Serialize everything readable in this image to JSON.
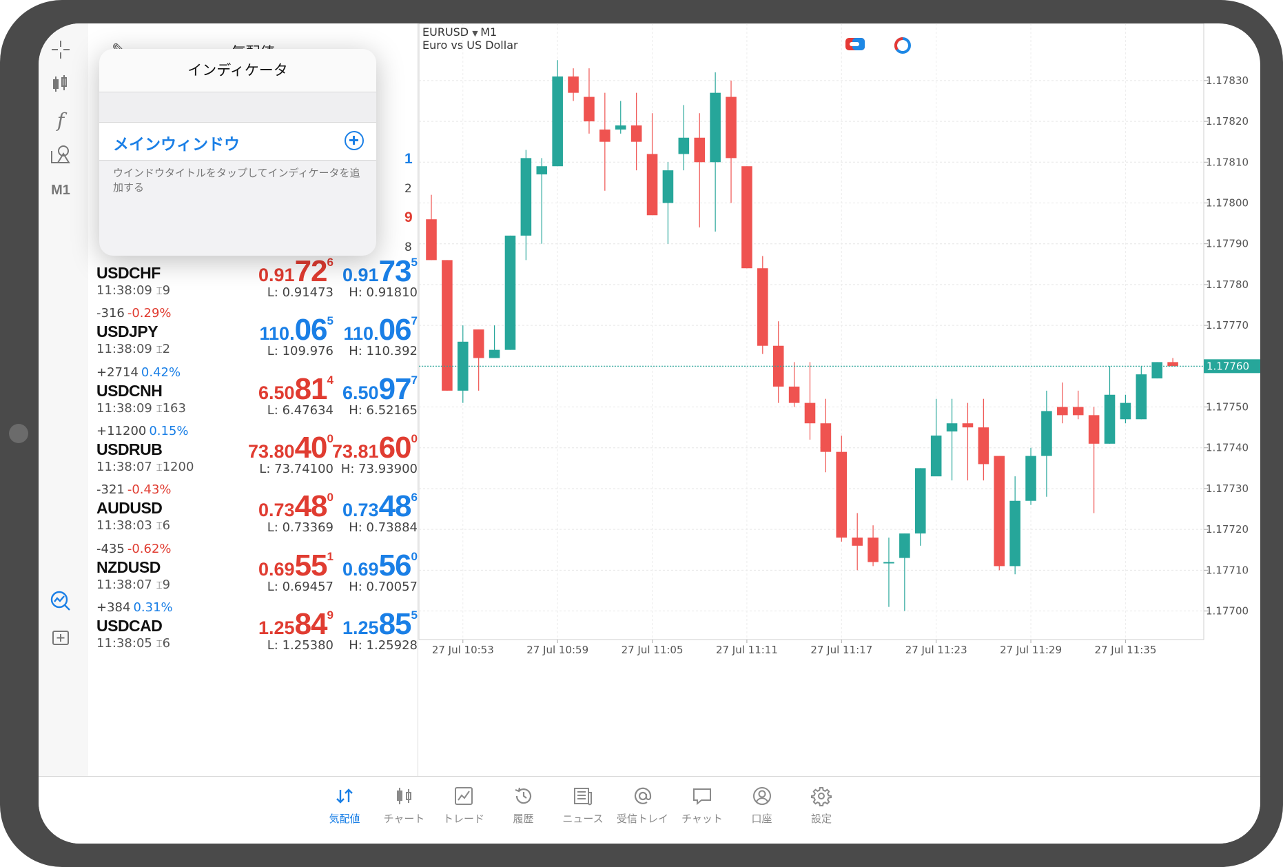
{
  "quotes_header": {
    "title": "気配値"
  },
  "popover": {
    "title": "インディケータ",
    "main_window_label": "メインウィンドウ",
    "hint": "ウインドウタイトルをタップしてインディケータを追加する"
  },
  "toolstrip": {
    "timeframe": "M1"
  },
  "partial_rows": [
    "1",
    "2",
    "9",
    "8"
  ],
  "quotes": [
    {
      "change": "",
      "pct": "",
      "pct_color": "",
      "symbol": "USDCHF",
      "time": "11:38:09",
      "spread": "9",
      "bid": {
        "small": "0.91",
        "big": "72",
        "pip": "6",
        "color": "red"
      },
      "ask": {
        "small": "0.91",
        "big": "73",
        "pip": "5",
        "color": "blue"
      },
      "low": "L: 0.91473",
      "high": "H: 0.91810"
    },
    {
      "change": "-316",
      "pct": "-0.29%",
      "pct_color": "red",
      "symbol": "USDJPY",
      "time": "11:38:09",
      "spread": "2",
      "bid": {
        "small": "110.",
        "big": "06",
        "pip": "5",
        "color": "blue"
      },
      "ask": {
        "small": "110.",
        "big": "06",
        "pip": "7",
        "color": "blue"
      },
      "low": "L: 109.976",
      "high": "H: 110.392"
    },
    {
      "change": "+2714",
      "pct": "0.42%",
      "pct_color": "blue",
      "symbol": "USDCNH",
      "time": "11:38:09",
      "spread": "163",
      "bid": {
        "small": "6.50",
        "big": "81",
        "pip": "4",
        "color": "red"
      },
      "ask": {
        "small": "6.50",
        "big": "97",
        "pip": "7",
        "color": "blue"
      },
      "low": "L: 6.47634",
      "high": "H: 6.52165"
    },
    {
      "change": "+11200",
      "pct": "0.15%",
      "pct_color": "blue",
      "symbol": "USDRUB",
      "time": "11:38:07",
      "spread": "1200",
      "bid": {
        "small": "73.80",
        "big": "40",
        "pip": "0",
        "color": "red"
      },
      "ask": {
        "small": "73.81",
        "big": "60",
        "pip": "0",
        "color": "red"
      },
      "low": "L: 73.74100",
      "high": "H: 73.93900"
    },
    {
      "change": "-321",
      "pct": "-0.43%",
      "pct_color": "red",
      "symbol": "AUDUSD",
      "time": "11:38:03",
      "spread": "6",
      "bid": {
        "small": "0.73",
        "big": "48",
        "pip": "0",
        "color": "red"
      },
      "ask": {
        "small": "0.73",
        "big": "48",
        "pip": "6",
        "color": "blue"
      },
      "low": "L: 0.73369",
      "high": "H: 0.73884"
    },
    {
      "change": "-435",
      "pct": "-0.62%",
      "pct_color": "red",
      "symbol": "NZDUSD",
      "time": "11:38:07",
      "spread": "9",
      "bid": {
        "small": "0.69",
        "big": "55",
        "pip": "1",
        "color": "red"
      },
      "ask": {
        "small": "0.69",
        "big": "56",
        "pip": "0",
        "color": "blue"
      },
      "low": "L: 0.69457",
      "high": "H: 0.70057"
    },
    {
      "change": "+384",
      "pct": "0.31%",
      "pct_color": "blue",
      "symbol": "USDCAD",
      "time": "11:38:05",
      "spread": "6",
      "bid": {
        "small": "1.25",
        "big": "84",
        "pip": "9",
        "color": "red"
      },
      "ask": {
        "small": "1.25",
        "big": "85",
        "pip": "5",
        "color": "blue"
      },
      "low": "L: 1.25380",
      "high": "H: 1.25928"
    }
  ],
  "chart_data": {
    "type": "candlestick",
    "symbol": "EURUSD",
    "timeframe": "M1",
    "description": "Euro vs US Dollar",
    "current_price": "1.17760",
    "y_ticks": [
      "1.17830",
      "1.17820",
      "1.17810",
      "1.17800",
      "1.17790",
      "1.17780",
      "1.17770",
      "1.17760",
      "1.17750",
      "1.17740",
      "1.17730",
      "1.17720",
      "1.17710",
      "1.17700"
    ],
    "x_ticks": [
      "27 Jul 10:53",
      "27 Jul 10:59",
      "27 Jul 11:05",
      "27 Jul 11:11",
      "27 Jul 11:17",
      "27 Jul 11:23",
      "27 Jul 11:29",
      "27 Jul 11:35"
    ],
    "y_range": [
      1.17693,
      1.17844
    ],
    "candles": [
      {
        "o": 1.17796,
        "h": 1.17802,
        "l": 1.17786,
        "c": 1.17786
      },
      {
        "o": 1.17786,
        "h": 1.17786,
        "l": 1.17754,
        "c": 1.17754
      },
      {
        "o": 1.17754,
        "h": 1.1777,
        "l": 1.17751,
        "c": 1.17766
      },
      {
        "o": 1.17769,
        "h": 1.17769,
        "l": 1.17754,
        "c": 1.17762
      },
      {
        "o": 1.17762,
        "h": 1.1777,
        "l": 1.17762,
        "c": 1.17764
      },
      {
        "o": 1.17764,
        "h": 1.17792,
        "l": 1.17764,
        "c": 1.17792
      },
      {
        "o": 1.17792,
        "h": 1.17813,
        "l": 1.17786,
        "c": 1.17811
      },
      {
        "o": 1.17807,
        "h": 1.17811,
        "l": 1.1779,
        "c": 1.17809
      },
      {
        "o": 1.17809,
        "h": 1.17835,
        "l": 1.17809,
        "c": 1.17831
      },
      {
        "o": 1.17831,
        "h": 1.17833,
        "l": 1.17825,
        "c": 1.17827
      },
      {
        "o": 1.17826,
        "h": 1.17833,
        "l": 1.17817,
        "c": 1.1782
      },
      {
        "o": 1.17818,
        "h": 1.17827,
        "l": 1.17803,
        "c": 1.17815
      },
      {
        "o": 1.17818,
        "h": 1.17825,
        "l": 1.17817,
        "c": 1.17819
      },
      {
        "o": 1.17819,
        "h": 1.17827,
        "l": 1.17808,
        "c": 1.17815
      },
      {
        "o": 1.17812,
        "h": 1.17822,
        "l": 1.17798,
        "c": 1.17797
      },
      {
        "o": 1.178,
        "h": 1.1781,
        "l": 1.1779,
        "c": 1.17808
      },
      {
        "o": 1.17812,
        "h": 1.17824,
        "l": 1.17808,
        "c": 1.17816
      },
      {
        "o": 1.17816,
        "h": 1.17822,
        "l": 1.17794,
        "c": 1.1781
      },
      {
        "o": 1.1781,
        "h": 1.17832,
        "l": 1.17793,
        "c": 1.17827
      },
      {
        "o": 1.17826,
        "h": 1.1783,
        "l": 1.178,
        "c": 1.17811
      },
      {
        "o": 1.17809,
        "h": 1.17809,
        "l": 1.17784,
        "c": 1.17784
      },
      {
        "o": 1.17784,
        "h": 1.17787,
        "l": 1.17763,
        "c": 1.17765
      },
      {
        "o": 1.17765,
        "h": 1.17771,
        "l": 1.17751,
        "c": 1.17755
      },
      {
        "o": 1.17755,
        "h": 1.17761,
        "l": 1.1775,
        "c": 1.17751
      },
      {
        "o": 1.17751,
        "h": 1.17761,
        "l": 1.17742,
        "c": 1.17746
      },
      {
        "o": 1.17746,
        "h": 1.17752,
        "l": 1.17734,
        "c": 1.17739
      },
      {
        "o": 1.17739,
        "h": 1.17743,
        "l": 1.17717,
        "c": 1.17718
      },
      {
        "o": 1.17718,
        "h": 1.17724,
        "l": 1.1771,
        "c": 1.17716
      },
      {
        "o": 1.17718,
        "h": 1.17721,
        "l": 1.17711,
        "c": 1.17712
      },
      {
        "o": 1.17712,
        "h": 1.17718,
        "l": 1.17701,
        "c": 1.17712
      },
      {
        "o": 1.17713,
        "h": 1.17719,
        "l": 1.177,
        "c": 1.17719
      },
      {
        "o": 1.17719,
        "h": 1.17735,
        "l": 1.17716,
        "c": 1.17735
      },
      {
        "o": 1.17733,
        "h": 1.17752,
        "l": 1.17734,
        "c": 1.17743
      },
      {
        "o": 1.17744,
        "h": 1.17752,
        "l": 1.17732,
        "c": 1.17746
      },
      {
        "o": 1.17746,
        "h": 1.17751,
        "l": 1.17732,
        "c": 1.17745
      },
      {
        "o": 1.17745,
        "h": 1.17752,
        "l": 1.17732,
        "c": 1.17736
      },
      {
        "o": 1.17738,
        "h": 1.17738,
        "l": 1.1771,
        "c": 1.17711
      },
      {
        "o": 1.17711,
        "h": 1.17733,
        "l": 1.17709,
        "c": 1.17727
      },
      {
        "o": 1.17727,
        "h": 1.1774,
        "l": 1.17726,
        "c": 1.17738
      },
      {
        "o": 1.17738,
        "h": 1.17754,
        "l": 1.17728,
        "c": 1.17749
      },
      {
        "o": 1.1775,
        "h": 1.17756,
        "l": 1.17746,
        "c": 1.17748
      },
      {
        "o": 1.1775,
        "h": 1.17754,
        "l": 1.17747,
        "c": 1.17748
      },
      {
        "o": 1.17748,
        "h": 1.1775,
        "l": 1.17724,
        "c": 1.17741
      },
      {
        "o": 1.17741,
        "h": 1.1776,
        "l": 1.17741,
        "c": 1.17753
      },
      {
        "o": 1.17747,
        "h": 1.17753,
        "l": 1.17746,
        "c": 1.17751
      },
      {
        "o": 1.17747,
        "h": 1.1776,
        "l": 1.17747,
        "c": 1.17758
      },
      {
        "o": 1.17757,
        "h": 1.17761,
        "l": 1.17757,
        "c": 1.17761
      },
      {
        "o": 1.17761,
        "h": 1.17762,
        "l": 1.1776,
        "c": 1.1776
      }
    ]
  },
  "tabs": [
    {
      "label": "気配値",
      "icon": "quotes-icon",
      "active": true
    },
    {
      "label": "チャート",
      "icon": "chart-icon",
      "active": false
    },
    {
      "label": "トレード",
      "icon": "trade-icon",
      "active": false
    },
    {
      "label": "履歴",
      "icon": "history-icon",
      "active": false
    },
    {
      "label": "ニュース",
      "icon": "news-icon",
      "active": false
    },
    {
      "label": "受信トレイ",
      "icon": "mailbox-icon",
      "active": false
    },
    {
      "label": "チャット",
      "icon": "chat-icon",
      "active": false
    },
    {
      "label": "口座",
      "icon": "account-icon",
      "active": false
    },
    {
      "label": "設定",
      "icon": "settings-icon",
      "active": false
    }
  ],
  "colors": {
    "bull": "#26a69a",
    "bear": "#ef5350",
    "accent": "#1a7fe6",
    "sell": "#e03c31",
    "price_line": "#26a69a"
  }
}
